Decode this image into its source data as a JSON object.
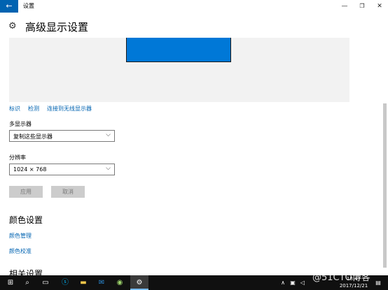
{
  "window": {
    "back_glyph": "←",
    "title": "设置",
    "minimize_glyph": "—",
    "maximize_glyph": "❐",
    "close_glyph": "✕"
  },
  "header": {
    "icon": "gear-icon",
    "title": "高级显示设置"
  },
  "preview": {
    "monitor_color": "#0078d7",
    "background_color": "#f2f2f2"
  },
  "display_links": {
    "identify": "标识",
    "detect": "检测",
    "connect_wireless": "连接到无线显示器"
  },
  "multiple_displays": {
    "label": "多显示器",
    "value": "复制这些显示器"
  },
  "resolution": {
    "label": "分辨率",
    "value": "1024 × 768"
  },
  "buttons": {
    "apply": "应用",
    "cancel": "取消"
  },
  "color_settings": {
    "title": "颜色设置",
    "color_management": "颜色管理",
    "color_calibration": "颜色校准"
  },
  "related_settings": {
    "title": "相关设置"
  },
  "taskbar": {
    "icons": [
      "windows-start-icon",
      "search-icon",
      "task-view-icon",
      "skype-icon",
      "file-explorer-icon",
      "outlook-icon",
      "media-icon",
      "settings-icon"
    ],
    "tray_chevron": "∧",
    "date_line1": "18:47",
    "date": "2017/12/21",
    "accent_color": "#76b9ed"
  },
  "watermark": "@51CTO博客",
  "accent": "#0063b1"
}
